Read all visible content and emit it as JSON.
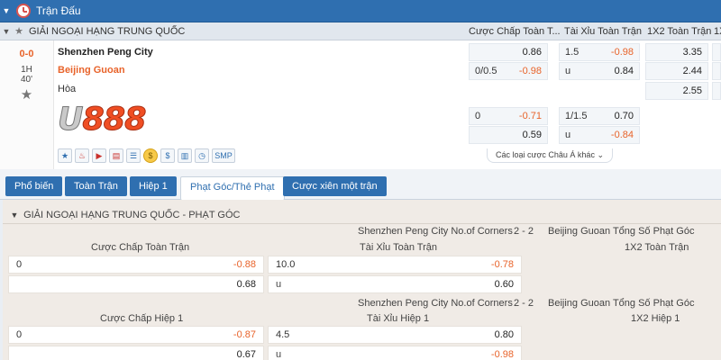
{
  "topbar": {
    "title": "Trận Đấu"
  },
  "league": {
    "name": "GIẢI NGOẠI HẠNG TRUNG QUỐC",
    "columns": [
      "Cược Chấp Toàn T...",
      "Tài Xỉu Toàn Trận",
      "1X2 Toàn Trận",
      "1X"
    ]
  },
  "match": {
    "score": "0-0",
    "period": "1H",
    "minute": "40'",
    "home": "Shenzhen Peng City",
    "away": "Beijing Guoan",
    "draw": "Hòa",
    "logo_text": "U888"
  },
  "odds": {
    "row1": {
      "hdp_line": "",
      "hdp_val": "0.86",
      "ou_line": "1.5",
      "ou_val": "-0.98",
      "x12": "3.35"
    },
    "row2": {
      "hdp_line": "0/0.5",
      "hdp_val": "-0.98",
      "ou_line": "u",
      "ou_val": "0.84",
      "x12": "2.44"
    },
    "row3": {
      "x12": "2.55"
    },
    "row4": {
      "hdp_line": "0",
      "hdp_val": "-0.71",
      "ou_line": "1/1.5",
      "ou_val": "0.70"
    },
    "row5": {
      "hdp_val": "0.59",
      "ou_line": "u",
      "ou_val": "-0.84"
    },
    "more_label": "Các loại cược Châu Á khác"
  },
  "icons": [
    "star-icon",
    "fire-icon",
    "play-icon",
    "stats-icon",
    "list-icon",
    "coin-icon",
    "dollar-icon",
    "chart-icon",
    "history-icon"
  ],
  "icon_smp": "SMP",
  "tabs": [
    "Phổ biến",
    "Toàn Trận",
    "Hiệp 1",
    "Phạt Góc/Thẻ Phạt",
    "Cược xiên một trận"
  ],
  "corners": {
    "header": "GIẢI NGOẠI HẠNG TRUNG QUỐC - PHẠT GÓC",
    "block1": {
      "home_label": "Shenzhen Peng City No.of Corners",
      "score": "2 - 2",
      "away_label": "Beijing Guoan Tổng Số Phạt Góc",
      "col_hdp": "Cược Chấp Toàn Trận",
      "col_ou": "Tài Xỉu Toàn Trận",
      "col_1x2": "1X2 Toàn Trận",
      "r1_hdp_line": "0",
      "r1_hdp_val": "-0.88",
      "r1_ou_line": "10.0",
      "r1_ou_val": "-0.78",
      "r2_hdp_val": "0.68",
      "r2_ou_line": "u",
      "r2_ou_val": "0.60"
    },
    "block2": {
      "home_label": "Shenzhen Peng City No.of Corners",
      "score": "2 - 2",
      "away_label": "Beijing Guoan Tổng Số Phạt Góc",
      "col_hdp": "Cược Chấp Hiệp 1",
      "col_ou": "Tài Xỉu Hiệp 1",
      "col_1x2": "1X2 Hiệp 1",
      "r1_hdp_line": "0",
      "r1_hdp_val": "-0.87",
      "r1_ou_line": "4.5",
      "r1_ou_val": "0.80",
      "r2_hdp_val": "0.67",
      "r2_ou_line": "u",
      "r2_ou_val": "-0.98"
    }
  }
}
